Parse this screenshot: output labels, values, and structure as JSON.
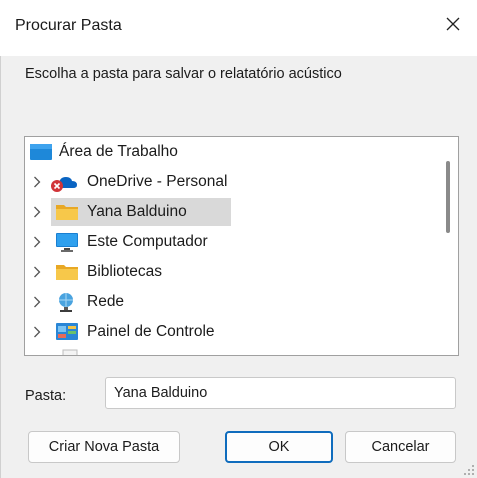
{
  "window": {
    "title": "Procurar Pasta",
    "close_icon": "close-icon"
  },
  "instruction": "Escolha a pasta para salvar o relatatório acústico",
  "tree": {
    "items": [
      {
        "label": "Área de Trabalho",
        "icon": "desktop-icon",
        "expandable": false,
        "selected": false
      },
      {
        "label": "OneDrive - Personal",
        "icon": "onedrive-error-icon",
        "expandable": true,
        "selected": false
      },
      {
        "label": "Yana Balduino",
        "icon": "folder-icon",
        "expandable": true,
        "selected": true
      },
      {
        "label": "Este Computador",
        "icon": "computer-icon",
        "expandable": true,
        "selected": false
      },
      {
        "label": "Bibliotecas",
        "icon": "libraries-icon",
        "expandable": true,
        "selected": false
      },
      {
        "label": "Rede",
        "icon": "network-icon",
        "expandable": true,
        "selected": false
      },
      {
        "label": "Painel de Controle",
        "icon": "control-panel-icon",
        "expandable": true,
        "selected": false
      }
    ]
  },
  "folder_field": {
    "label": "Pasta:",
    "value": "Yana Balduino"
  },
  "buttons": {
    "new_folder": "Criar Nova Pasta",
    "ok": "OK",
    "cancel": "Cancelar"
  },
  "colors": {
    "accent": "#0f6cbd",
    "selection": "#d9d9d9",
    "folder": "#f7c84a",
    "error": "#d13438"
  }
}
